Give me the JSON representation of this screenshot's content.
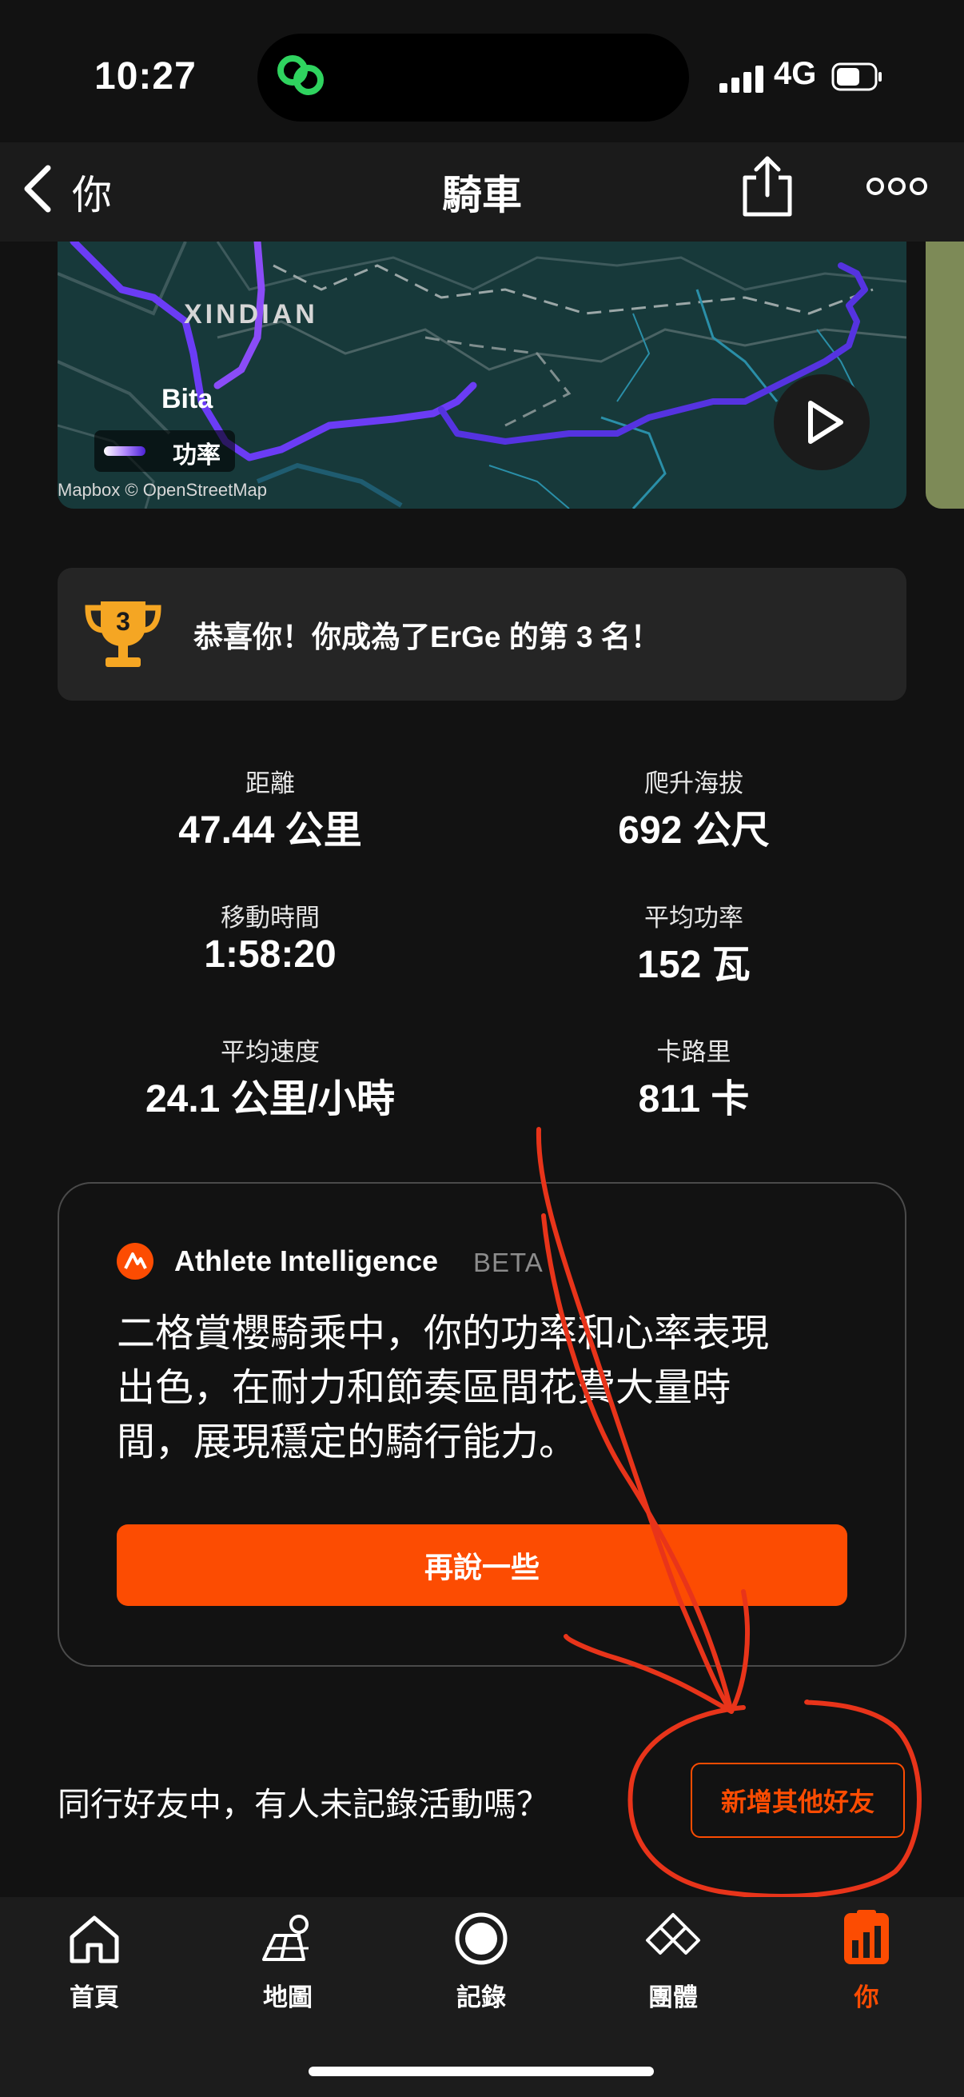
{
  "status_bar": {
    "time": "10:27",
    "network": "4G"
  },
  "nav": {
    "back_label": "你",
    "title": "騎車"
  },
  "map": {
    "town_label": "XINDIAN",
    "place_label": "Bita",
    "legend_label": "功率",
    "credit": "Mapbox © OpenStreetMap",
    "route_color": "#6b3cf5"
  },
  "achievement": {
    "text": "恭喜你！你成為了ErGe 的第 3 名！",
    "rank": "3"
  },
  "stats": [
    {
      "label": "距離",
      "value": "47.44 公里"
    },
    {
      "label": "爬升海拔",
      "value": "692 公尺"
    },
    {
      "label": "移動時間",
      "value": "1:58:20"
    },
    {
      "label": "平均功率",
      "value": "152 瓦"
    },
    {
      "label": "平均速度",
      "value": "24.1 公里/小時"
    },
    {
      "label": "卡路里",
      "value": "811 卡"
    }
  ],
  "athlete_intelligence": {
    "title": "Athlete Intelligence",
    "badge": "BETA",
    "lines": [
      "二格賞櫻騎乘中，你的功率和心率表現",
      "出色，在耐力和節奏區間花費大量時",
      "間，展現穩定的騎行能力。"
    ],
    "button_label": "再說一些"
  },
  "friends": {
    "question": "同行好友中，有人未記錄活動嗎？",
    "button_label": "新增其他好友"
  },
  "tabs": [
    {
      "label": "首頁",
      "icon": "home-icon"
    },
    {
      "label": "地圖",
      "icon": "map-icon"
    },
    {
      "label": "記錄",
      "icon": "record-icon"
    },
    {
      "label": "團體",
      "icon": "groups-icon"
    },
    {
      "label": "你",
      "icon": "you-icon",
      "active": true
    }
  ],
  "colors": {
    "accent": "#fc4c02",
    "trophy": "#f5a623",
    "background": "#121212"
  }
}
